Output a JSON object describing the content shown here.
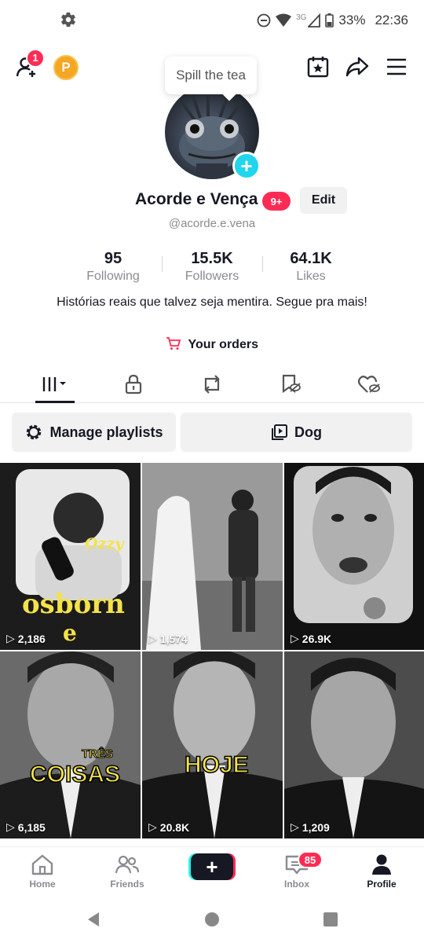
{
  "status_bar": {
    "battery": "33%",
    "time": "22:36",
    "network": "3G"
  },
  "topbar": {
    "add_friend_badge": "1",
    "coin_letter": "P"
  },
  "tooltip": {
    "text": "Spill the tea"
  },
  "profile": {
    "name": "Acorde e Vença",
    "name_badge": "9+",
    "edit_label": "Edit",
    "handle": "@acorde.e.vena",
    "stats": [
      {
        "value": "95",
        "label": "Following"
      },
      {
        "value": "15.5K",
        "label": "Followers"
      },
      {
        "value": "64.1K",
        "label": "Likes"
      }
    ],
    "bio": "Histórias reais que talvez seja mentira. Segue pra mais!",
    "orders_label": "Your orders"
  },
  "playlists": {
    "manage_label": "Manage playlists",
    "playlist_name": "Dog"
  },
  "videos": [
    {
      "views": "2,186",
      "overlay_top": "Ozzy",
      "overlay_bottom": "osborn",
      "overlay_extra": "e"
    },
    {
      "views": "1,574"
    },
    {
      "views": "26.9K"
    },
    {
      "views": "6,185",
      "overlay_top": "TRÊS",
      "overlay_bottom": "COISAS"
    },
    {
      "views": "20.8K",
      "overlay_bottom": "HOJE"
    },
    {
      "views": "1,209"
    }
  ],
  "bottom_nav": {
    "items": [
      {
        "label": "Home"
      },
      {
        "label": "Friends"
      },
      {
        "label": ""
      },
      {
        "label": "Inbox"
      },
      {
        "label": "Profile"
      }
    ],
    "inbox_badge": "85"
  },
  "colors": {
    "accent": "#fe2c55",
    "cyan": "#20d5ec",
    "text": "#161823",
    "muted": "#8a8b91"
  }
}
